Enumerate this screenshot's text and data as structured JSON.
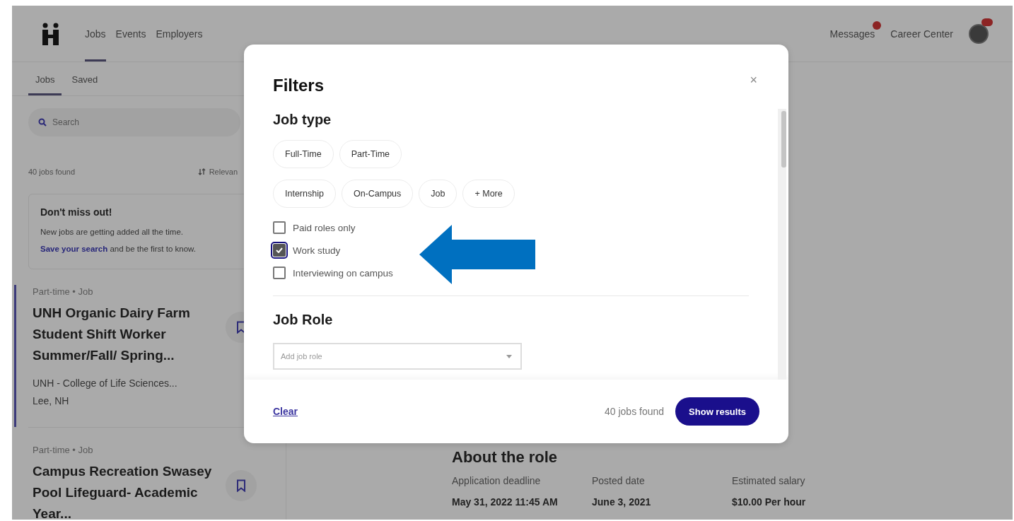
{
  "nav": {
    "links": [
      {
        "label": "Jobs",
        "selected": true
      },
      {
        "label": "Events",
        "selected": false
      },
      {
        "label": "Employers",
        "selected": false
      }
    ],
    "right": [
      {
        "kind": "link",
        "label": "Messages",
        "badge": true
      },
      {
        "kind": "link",
        "label": "Career Center",
        "badge": false
      },
      {
        "kind": "avatar",
        "badge": true
      }
    ]
  },
  "sidebar": {
    "tabs": [
      {
        "label": "Jobs",
        "selected": true
      },
      {
        "label": "Saved",
        "selected": false
      }
    ],
    "search": {
      "placeholder": "Search"
    },
    "count": "40 jobs found",
    "sort": "Relevan",
    "promo": {
      "title": "Don't miss out!",
      "text": "New jobs are getting added all the time.",
      "link": "Save your search",
      "after": " and be the first to know."
    },
    "jobs": [
      {
        "meta": "Part-time • Job",
        "title": "UNH Organic Dairy Farm Student Shift Worker Summer/Fall/ Spring...",
        "employer": "UNH - College of Life Sciences...",
        "location": "Lee, NH",
        "selected": true
      },
      {
        "meta": "Part-time • Job",
        "title": "Campus Recreation Swasey Pool Lifeguard- Academic Year...",
        "selected": false
      }
    ]
  },
  "details": {
    "heading": "About the role",
    "facts": [
      {
        "label": "Application deadline",
        "value": "May 31, 2022 11:45 AM"
      },
      {
        "label": "Posted date",
        "value": "June 3, 2021"
      },
      {
        "label": "Estimated salary",
        "value": "$10.00 Per hour"
      }
    ]
  },
  "modal": {
    "title": "Filters",
    "close": "×",
    "job_type": {
      "heading": "Job type",
      "chip_rows": [
        [
          {
            "label": "Full-Time",
            "selected": false
          },
          {
            "label": "Part-Time",
            "selected": false
          }
        ],
        [
          {
            "label": "Internship",
            "selected": false
          },
          {
            "label": "On-Campus",
            "selected": false
          },
          {
            "label": "Job",
            "selected": false
          },
          {
            "label": "+ More",
            "selected": false
          }
        ]
      ],
      "options": [
        {
          "label": "Paid roles only",
          "checked": false
        },
        {
          "label": "Work study",
          "checked": true
        },
        {
          "label": "Interviewing on campus",
          "checked": false
        }
      ]
    },
    "job_role": {
      "heading": "Job Role",
      "placeholder": "Add job role"
    },
    "footer": {
      "clear": "Clear",
      "count": "40 jobs found",
      "submit": "Show results"
    }
  }
}
